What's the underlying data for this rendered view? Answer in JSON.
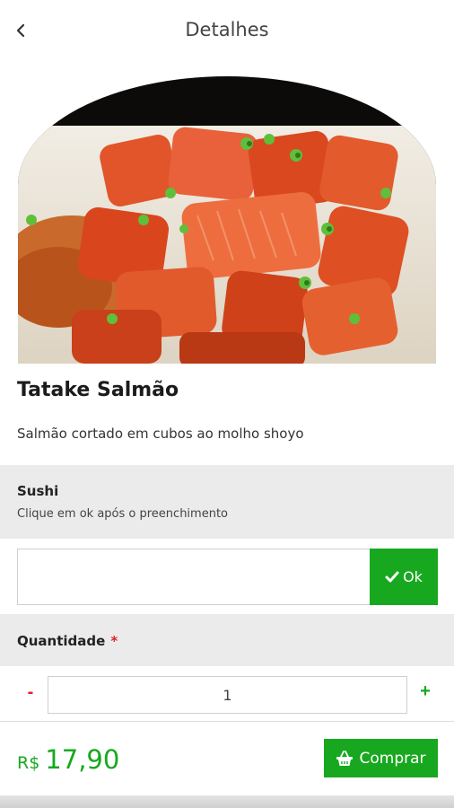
{
  "header": {
    "title": "Detalhes",
    "back_icon": "chevron-left-icon"
  },
  "product": {
    "image_alt": "Tatake Salmão",
    "name": "Tatake Salmão",
    "description": "Salmão cortado em cubos ao molho shoyo"
  },
  "sushi_section": {
    "title": "Sushi",
    "subtitle": "Clique em ok após o preenchimento",
    "input_value": "",
    "input_placeholder": "",
    "ok_icon": "check-icon",
    "ok_label": "Ok"
  },
  "quantity_section": {
    "title": "Quantidade",
    "required_mark": "*",
    "minus_label": "-",
    "value": "1",
    "plus_label": "+"
  },
  "footer": {
    "currency": "R$",
    "price": "17,90",
    "buy_icon": "basket-icon",
    "buy_label": "Comprar"
  },
  "colors": {
    "accent_green": "#18a81f",
    "required_red": "#e0202a",
    "section_bg": "#ebebeb"
  }
}
